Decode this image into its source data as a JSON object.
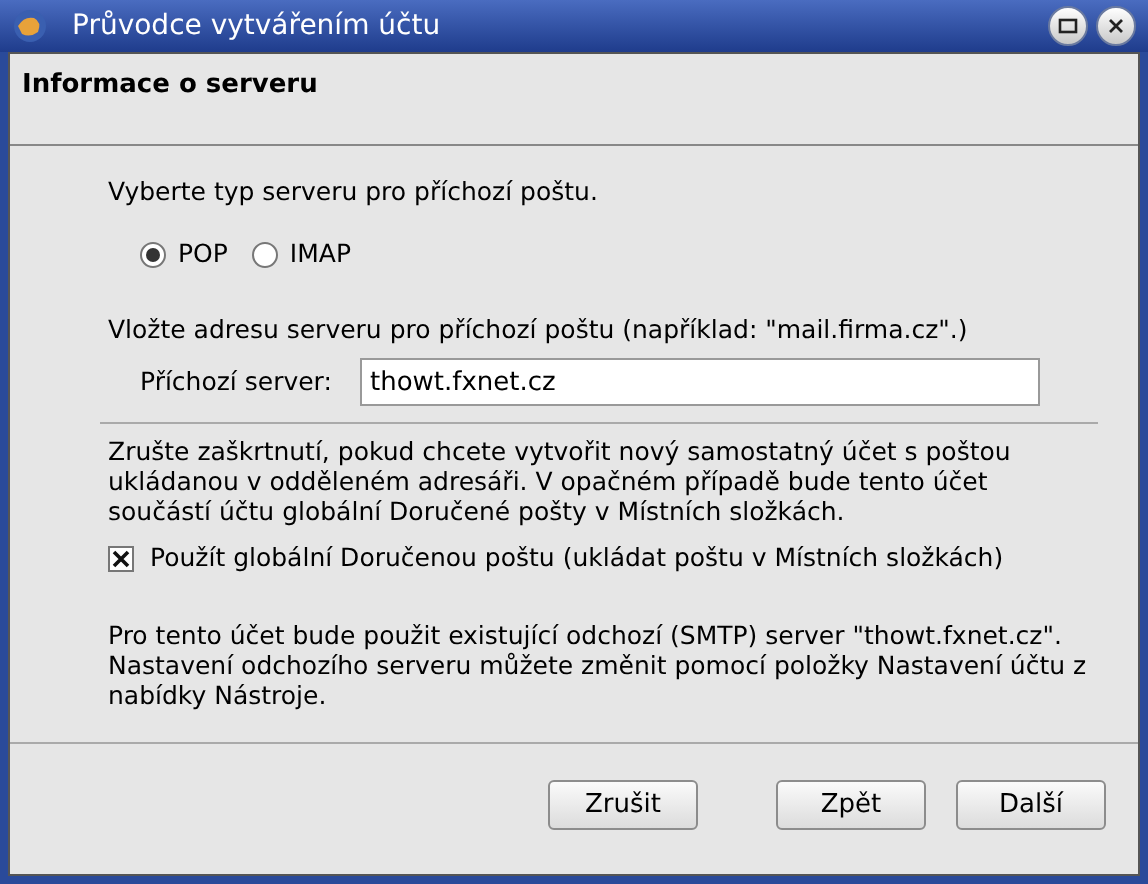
{
  "window": {
    "title": "Průvodce vytvářením účtu"
  },
  "header": {
    "title": "Informace o serveru"
  },
  "server_type": {
    "prompt": "Vyberte typ serveru pro příchozí poštu.",
    "options": [
      {
        "label": "POP",
        "selected": true
      },
      {
        "label": "IMAP",
        "selected": false
      }
    ]
  },
  "server_address": {
    "prompt": "Vložte adresu serveru pro příchozí poštu (například: \"mail.firma.cz\".)",
    "label": "Příchozí server:",
    "value": "thowt.fxnet.cz"
  },
  "inbox": {
    "description": "Zrušte zaškrtnutí, pokud chcete vytvořit nový samostatný účet s poštou ukládanou v odděleném adresáři. V opačném případě bude tento účet součástí účtu globální Doručené pošty v Místních složkách.",
    "checkbox": {
      "label": "Použít globální Doručenou poštu (ukládat poštu v Místních složkách)",
      "checked": true
    }
  },
  "smtp_note": "Pro tento účet bude použit existující odchozí (SMTP) server \"thowt.fxnet.cz\". Nastavení odchozího serveru můžete změnit pomocí položky Nastavení účtu z nabídky Nástroje.",
  "buttons": [
    "Zrušit",
    "Zpět",
    "Další"
  ]
}
